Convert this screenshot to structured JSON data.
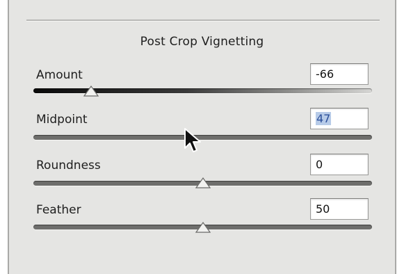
{
  "panel": {
    "title": "Post Crop Vignetting",
    "sliders": [
      {
        "label": "Amount",
        "value": "-66",
        "numeric": -66,
        "min": -100,
        "max": 100,
        "track": "gradient-black-to-white"
      },
      {
        "label": "Midpoint",
        "value": "47",
        "numeric": 47,
        "min": 0,
        "max": 100,
        "selected": true
      },
      {
        "label": "Roundness",
        "value": "0",
        "numeric": 0,
        "min": -100,
        "max": 100
      },
      {
        "label": "Feather",
        "value": "50",
        "numeric": 50,
        "min": 0,
        "max": 100
      }
    ]
  },
  "icons": {
    "cursor": "arrow-pointer-icon",
    "thumb": "slider-thumb-icon"
  },
  "colors": {
    "panel_bg": "#e5e5e3",
    "selection": "#b7cbe8"
  }
}
